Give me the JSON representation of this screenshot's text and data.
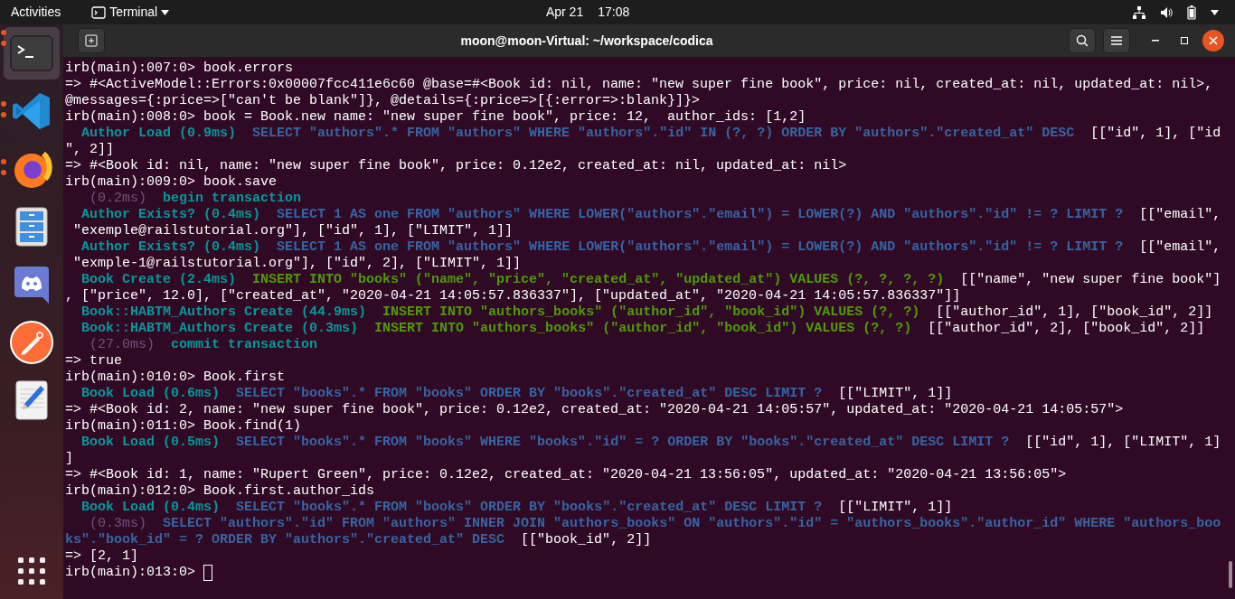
{
  "top_bar": {
    "activities": "Activities",
    "app_menu": "Terminal",
    "date": "Apr 21",
    "time": "17:08"
  },
  "dock": {
    "items": [
      {
        "kind": "terminal",
        "selected": true,
        "running": true
      },
      {
        "kind": "code-editor",
        "selected": false,
        "running": true
      },
      {
        "kind": "browser",
        "selected": false,
        "running": true
      },
      {
        "kind": "files",
        "selected": false,
        "running": false
      },
      {
        "kind": "chat",
        "selected": false,
        "running": false
      },
      {
        "kind": "api-client",
        "selected": false,
        "running": false
      },
      {
        "kind": "text-editor",
        "selected": false,
        "running": false
      }
    ]
  },
  "window": {
    "title": "moon@moon-Virtual: ~/workspace/codica",
    "lines": [
      {
        "segments": [
          {
            "kind": "plain",
            "text": "irb(main):007:0> book.errors"
          }
        ]
      },
      {
        "segments": [
          {
            "kind": "plain",
            "text": "=> #<ActiveModel::Errors:0x00007fcc411e6c60 @base=#<Book id: nil, name: \"new super fine book\", price: nil, created_at: nil, updated_at: nil>,"
          }
        ]
      },
      {
        "segments": [
          {
            "kind": "plain",
            "text": "@messages={:price=>[\"can't be blank\"]}, @details={:price=>[{:error=>:blank}]}>"
          }
        ]
      },
      {
        "segments": [
          {
            "kind": "plain",
            "text": "irb(main):008:0> book = Book.new name: \"new super fine book\", price: 12,  author_ids: [1,2]"
          }
        ]
      },
      {
        "segments": [
          {
            "kind": "label",
            "text": "  Author Load (0.9ms)"
          },
          {
            "kind": "select",
            "text": "  SELECT \"authors\".* FROM \"authors\" WHERE \"authors\".\"id\" IN (?, ?) ORDER BY \"authors\".\"created_at\" DESC"
          },
          {
            "kind": "plain",
            "text": "  [[\"id\", 1], [\"id"
          }
        ]
      },
      {
        "segments": [
          {
            "kind": "plain",
            "text": "\", 2]]"
          }
        ]
      },
      {
        "segments": [
          {
            "kind": "plain",
            "text": "=> #<Book id: nil, name: \"new super fine book\", price: 0.12e2, created_at: nil, updated_at: nil>"
          }
        ]
      },
      {
        "segments": [
          {
            "kind": "plain",
            "text": "irb(main):009:0> book.save"
          }
        ]
      },
      {
        "segments": [
          {
            "kind": "duration",
            "text": "   (0.2ms)"
          },
          {
            "kind": "label",
            "text": "  begin transaction"
          }
        ]
      },
      {
        "segments": [
          {
            "kind": "label",
            "text": "  Author Exists? (0.4ms)"
          },
          {
            "kind": "select",
            "text": "  SELECT 1 AS one FROM \"authors\" WHERE LOWER(\"authors\".\"email\") = LOWER(?) AND \"authors\".\"id\" != ? LIMIT ?"
          },
          {
            "kind": "plain",
            "text": "  [[\"email\","
          }
        ]
      },
      {
        "segments": [
          {
            "kind": "plain",
            "text": " \"exemple@railstutorial.org\"], [\"id\", 1], [\"LIMIT\", 1]]"
          }
        ]
      },
      {
        "segments": [
          {
            "kind": "label",
            "text": "  Author Exists? (0.4ms)"
          },
          {
            "kind": "select",
            "text": "  SELECT 1 AS one FROM \"authors\" WHERE LOWER(\"authors\".\"email\") = LOWER(?) AND \"authors\".\"id\" != ? LIMIT ?"
          },
          {
            "kind": "plain",
            "text": "  [[\"email\","
          }
        ]
      },
      {
        "segments": [
          {
            "kind": "plain",
            "text": " \"exmple-1@railstutorial.org\"], [\"id\", 2], [\"LIMIT\", 1]]"
          }
        ]
      },
      {
        "segments": [
          {
            "kind": "label",
            "text": "  Book Create (2.4ms)"
          },
          {
            "kind": "insert",
            "text": "  INSERT INTO \"books\" (\"name\", \"price\", \"created_at\", \"updated_at\") VALUES (?, ?, ?, ?)"
          },
          {
            "kind": "plain",
            "text": "  [[\"name\", \"new super fine book\"]"
          }
        ]
      },
      {
        "segments": [
          {
            "kind": "plain",
            "text": ", [\"price\", 12.0], [\"created_at\", \"2020-04-21 14:05:57.836337\"], [\"updated_at\", \"2020-04-21 14:05:57.836337\"]]"
          }
        ]
      },
      {
        "segments": [
          {
            "kind": "label",
            "text": "  Book::HABTM_Authors Create (44.9ms)"
          },
          {
            "kind": "insert",
            "text": "  INSERT INTO \"authors_books\" (\"author_id\", \"book_id\") VALUES (?, ?)"
          },
          {
            "kind": "plain",
            "text": "  [[\"author_id\", 1], [\"book_id\", 2]]"
          }
        ]
      },
      {
        "segments": [
          {
            "kind": "label",
            "text": "  Book::HABTM_Authors Create (0.3ms)"
          },
          {
            "kind": "insert",
            "text": "  INSERT INTO \"authors_books\" (\"author_id\", \"book_id\") VALUES (?, ?)"
          },
          {
            "kind": "plain",
            "text": "  [[\"author_id\", 2], [\"book_id\", 2]]"
          }
        ]
      },
      {
        "segments": [
          {
            "kind": "duration",
            "text": "   (27.0ms)"
          },
          {
            "kind": "label",
            "text": "  commit transaction"
          }
        ]
      },
      {
        "segments": [
          {
            "kind": "plain",
            "text": "=> true"
          }
        ]
      },
      {
        "segments": [
          {
            "kind": "plain",
            "text": "irb(main):010:0> Book.first"
          }
        ]
      },
      {
        "segments": [
          {
            "kind": "label",
            "text": "  Book Load (0.6ms)"
          },
          {
            "kind": "select",
            "text": "  SELECT \"books\".* FROM \"books\" ORDER BY \"books\".\"created_at\" DESC LIMIT ?"
          },
          {
            "kind": "plain",
            "text": "  [[\"LIMIT\", 1]]"
          }
        ]
      },
      {
        "segments": [
          {
            "kind": "plain",
            "text": "=> #<Book id: 2, name: \"new super fine book\", price: 0.12e2, created_at: \"2020-04-21 14:05:57\", updated_at: \"2020-04-21 14:05:57\">"
          }
        ]
      },
      {
        "segments": [
          {
            "kind": "plain",
            "text": "irb(main):011:0> Book.find(1)"
          }
        ]
      },
      {
        "segments": [
          {
            "kind": "label",
            "text": "  Book Load (0.5ms)"
          },
          {
            "kind": "select",
            "text": "  SELECT \"books\".* FROM \"books\" WHERE \"books\".\"id\" = ? ORDER BY \"books\".\"created_at\" DESC LIMIT ?"
          },
          {
            "kind": "plain",
            "text": "  [[\"id\", 1], [\"LIMIT\", 1]"
          }
        ]
      },
      {
        "segments": [
          {
            "kind": "plain",
            "text": "]"
          }
        ]
      },
      {
        "segments": [
          {
            "kind": "plain",
            "text": "=> #<Book id: 1, name: \"Rupert Green\", price: 0.12e2, created_at: \"2020-04-21 13:56:05\", updated_at: \"2020-04-21 13:56:05\">"
          }
        ]
      },
      {
        "segments": [
          {
            "kind": "plain",
            "text": "irb(main):012:0> Book.first.author_ids"
          }
        ]
      },
      {
        "segments": [
          {
            "kind": "label",
            "text": "  Book Load (0.4ms)"
          },
          {
            "kind": "select",
            "text": "  SELECT \"books\".* FROM \"books\" ORDER BY \"books\".\"created_at\" DESC LIMIT ?"
          },
          {
            "kind": "plain",
            "text": "  [[\"LIMIT\", 1]]"
          }
        ]
      },
      {
        "segments": [
          {
            "kind": "duration",
            "text": "   (0.3ms)"
          },
          {
            "kind": "select",
            "text": "  SELECT \"authors\".\"id\" FROM \"authors\" INNER JOIN \"authors_books\" ON \"authors\".\"id\" = \"authors_books\".\"author_id\" WHERE \"authors_boo"
          }
        ]
      },
      {
        "segments": [
          {
            "kind": "select",
            "text": "ks\".\"book_id\" = ? ORDER BY \"authors\".\"created_at\" DESC"
          },
          {
            "kind": "plain",
            "text": "  [[\"book_id\", 2]]"
          }
        ]
      },
      {
        "segments": [
          {
            "kind": "plain",
            "text": "=> [2, 1]"
          }
        ]
      },
      {
        "segments": [
          {
            "kind": "plain",
            "text": "irb(main):013:0>"
          }
        ],
        "cursor": true
      }
    ]
  }
}
